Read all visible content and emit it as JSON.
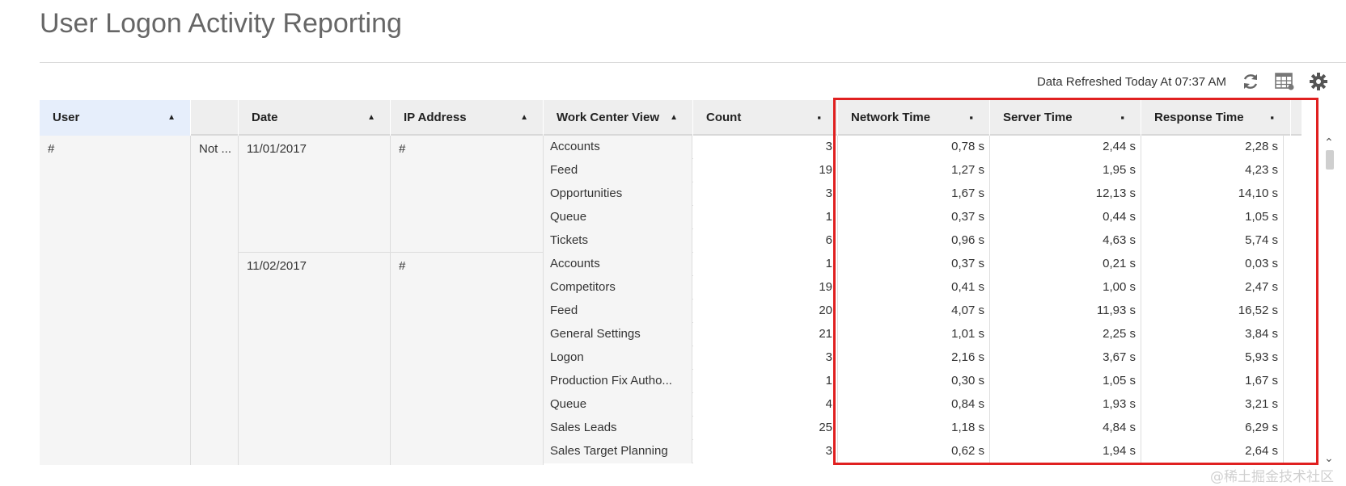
{
  "page": {
    "title": "User Logon Activity Reporting"
  },
  "toolbar": {
    "refresh_status": "Data Refreshed Today At 07:37 AM",
    "icons": [
      "refresh-icon",
      "table-settings-icon",
      "gear-icon"
    ]
  },
  "table": {
    "columns": [
      {
        "label": "User",
        "indicator": "▲"
      },
      {
        "label": "",
        "indicator": ""
      },
      {
        "label": "Date",
        "indicator": "▲"
      },
      {
        "label": "IP Address",
        "indicator": "▲"
      },
      {
        "label": "Work Center View",
        "indicator": "▲"
      },
      {
        "label": "Count",
        "indicator": "▪"
      },
      {
        "label": "Network Time",
        "indicator": "▪"
      },
      {
        "label": "Server Time",
        "indicator": "▪"
      },
      {
        "label": "Response Time",
        "indicator": "▪"
      }
    ],
    "user": "#",
    "status": "Not ...",
    "groups": [
      {
        "date": "11/01/2017",
        "ip": "#"
      },
      {
        "date": "11/02/2017",
        "ip": "#"
      }
    ],
    "rows": [
      {
        "wcv": "Accounts",
        "count": "3",
        "network": "0,78 s",
        "server": "2,44 s",
        "response": "2,28 s"
      },
      {
        "wcv": "Feed",
        "count": "19",
        "network": "1,27 s",
        "server": "1,95 s",
        "response": "4,23 s"
      },
      {
        "wcv": "Opportunities",
        "count": "3",
        "network": "1,67 s",
        "server": "12,13 s",
        "response": "14,10 s"
      },
      {
        "wcv": "Queue",
        "count": "1",
        "network": "0,37 s",
        "server": "0,44 s",
        "response": "1,05 s"
      },
      {
        "wcv": "Tickets",
        "count": "6",
        "network": "0,96 s",
        "server": "4,63 s",
        "response": "5,74 s"
      },
      {
        "wcv": "Accounts",
        "count": "1",
        "network": "0,37 s",
        "server": "0,21 s",
        "response": "0,03 s"
      },
      {
        "wcv": "Competitors",
        "count": "19",
        "network": "0,41 s",
        "server": "1,00 s",
        "response": "2,47 s"
      },
      {
        "wcv": "Feed",
        "count": "20",
        "network": "4,07 s",
        "server": "11,93 s",
        "response": "16,52 s"
      },
      {
        "wcv": "General Settings",
        "count": "21",
        "network": "1,01 s",
        "server": "2,25 s",
        "response": "3,84 s"
      },
      {
        "wcv": "Logon",
        "count": "3",
        "network": "2,16 s",
        "server": "3,67 s",
        "response": "5,93 s"
      },
      {
        "wcv": "Production Fix Autho...",
        "count": "1",
        "network": "0,30 s",
        "server": "1,05 s",
        "response": "1,67 s"
      },
      {
        "wcv": "Queue",
        "count": "4",
        "network": "0,84 s",
        "server": "1,93 s",
        "response": "3,21 s"
      },
      {
        "wcv": "Sales Leads",
        "count": "25",
        "network": "1,18 s",
        "server": "4,84 s",
        "response": "6,29 s"
      },
      {
        "wcv": "Sales Target Planning",
        "count": "3",
        "network": "0,62 s",
        "server": "1,94 s",
        "response": "2,64 s"
      }
    ]
  },
  "scrollbar": {
    "up": "⌃",
    "down": "⌄"
  },
  "watermark": "@稀土掘金技术社区",
  "colors": {
    "highlight": "#e02020",
    "user_header": "#e6eefb",
    "header": "#eeeeee"
  }
}
